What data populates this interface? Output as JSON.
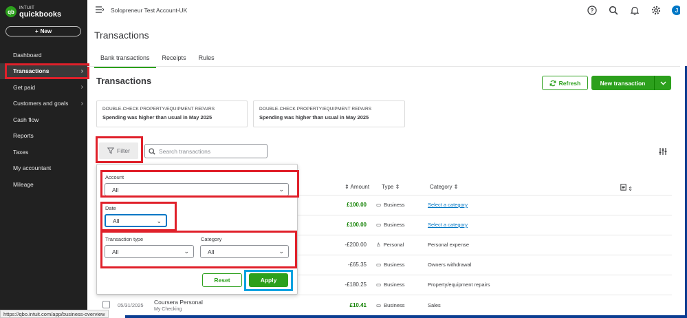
{
  "app": {
    "logo_line1": "INTUIT",
    "logo_line2": "quickbooks",
    "logo_mark": "qb",
    "new_button": "New"
  },
  "sidebar": {
    "items": [
      {
        "label": "Dashboard",
        "chevron": false
      },
      {
        "label": "Transactions",
        "chevron": true,
        "active": true
      },
      {
        "label": "Get paid",
        "chevron": true
      },
      {
        "label": "Customers and goals",
        "chevron": true
      },
      {
        "label": "Cash flow",
        "chevron": false
      },
      {
        "label": "Reports",
        "chevron": false
      },
      {
        "label": "Taxes",
        "chevron": false
      },
      {
        "label": "My accountant",
        "chevron": false
      },
      {
        "label": "Mileage",
        "chevron": false
      }
    ]
  },
  "topbar": {
    "company": "Solopreneur Test Account-UK",
    "avatar_initial": "J",
    "icons": [
      "help-icon",
      "search-icon",
      "bell-icon",
      "gear-icon"
    ]
  },
  "page": {
    "title": "Transactions",
    "tabs": [
      "Bank transactions",
      "Receipts",
      "Rules"
    ],
    "section_title": "Transactions",
    "refresh": "Refresh",
    "new_transaction": "New transaction"
  },
  "cards": [
    {
      "title": "DOUBLE-CHECK PROPERTY/EQUIPMENT REPAIRS",
      "subtitle": "Spending was higher than usual in May 2025"
    },
    {
      "title": "DOUBLE-CHECK PROPERTY/EQUIPMENT REPAIRS",
      "subtitle": "Spending was higher than usual in May 2025"
    }
  ],
  "filter": {
    "button": "Filter",
    "search_placeholder": "Search transactions",
    "account_label": "Account",
    "account_value": "All",
    "date_label": "Date",
    "date_value": "All",
    "type_label": "Transaction type",
    "type_value": "All",
    "category_label": "Category",
    "category_value": "All",
    "reset": "Reset",
    "apply": "Apply"
  },
  "table": {
    "headers": {
      "amount": "Amount",
      "type": "Type",
      "category": "Category"
    },
    "rows": [
      {
        "amount": "£100.00",
        "type": "Business",
        "category": "Select a category",
        "positive": true,
        "link": true
      },
      {
        "amount": "£100.00",
        "type": "Business",
        "category": "Select a category",
        "positive": true,
        "link": true
      },
      {
        "amount": "-£200.00",
        "type": "Personal",
        "category": "Personal expense",
        "positive": false,
        "link": false
      },
      {
        "amount": "-£65.35",
        "type": "Business",
        "category": "Owners withdrawal",
        "positive": false,
        "link": false
      },
      {
        "amount": "-£180.25",
        "type": "Business",
        "category": "Property/equipment repairs",
        "positive": false,
        "link": false
      },
      {
        "amount": "£10.41",
        "type": "Business",
        "category": "Sales",
        "positive": true,
        "link": false,
        "date": "05/31/2025",
        "description": "Coursera Personal",
        "account": "My Checking"
      }
    ]
  },
  "status_url": "https://qbo.intuit.com/app/business-overview",
  "colors": {
    "brand_green": "#2ca01c",
    "link_blue": "#0077c5",
    "highlight_red": "#e0202a",
    "highlight_blue": "#00a2e0"
  }
}
